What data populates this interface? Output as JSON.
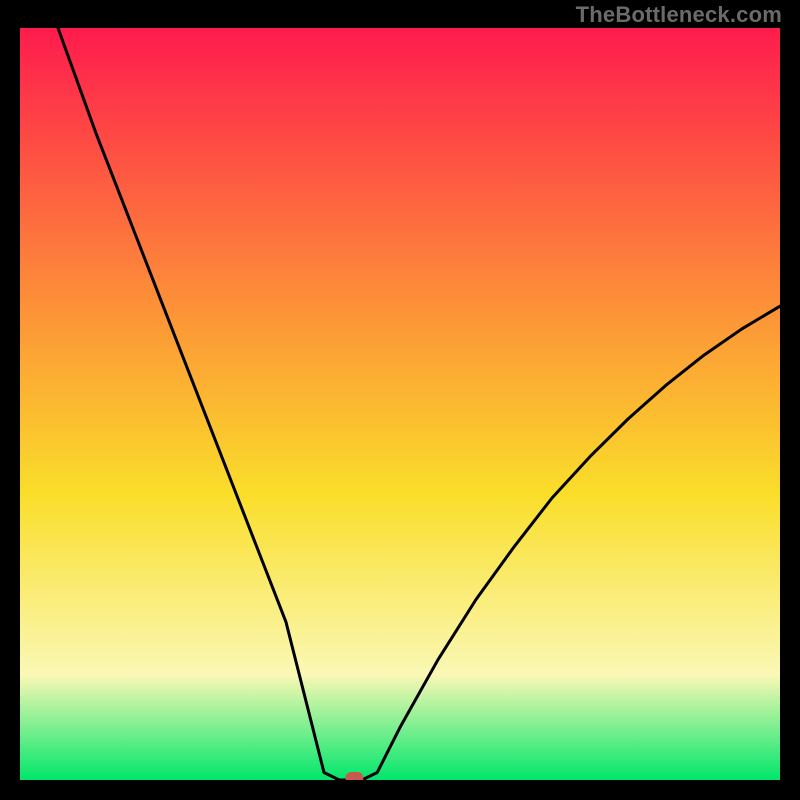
{
  "watermark": "TheBottleneck.com",
  "chart_data": {
    "type": "line",
    "title": "",
    "xlabel": "",
    "ylabel": "",
    "xlim": [
      0,
      100
    ],
    "ylim": [
      0,
      100
    ],
    "grid": false,
    "legend": false,
    "series": [
      {
        "name": "curve",
        "x": [
          5,
          10,
          15,
          20,
          25,
          30,
          35,
          38,
          40,
          42,
          45,
          47,
          50,
          55,
          60,
          65,
          70,
          75,
          80,
          85,
          90,
          95,
          100
        ],
        "values": [
          100,
          86,
          73,
          60,
          47,
          34,
          21,
          9,
          1,
          0,
          0,
          1,
          7,
          16,
          24,
          31,
          37.5,
          43,
          48,
          52.5,
          56.5,
          60,
          63
        ]
      }
    ],
    "marker": {
      "x": 44,
      "y": 0
    },
    "colors": {
      "gradient_top": "#fe1b4d",
      "gradient_mid_upper": "#fd8b39",
      "gradient_mid": "#fade2a",
      "gradient_low": "#faf8b5",
      "gradient_bottom": "#00e66b",
      "curve": "#000000",
      "marker": "#c55a4d",
      "frame": "#000000"
    }
  }
}
